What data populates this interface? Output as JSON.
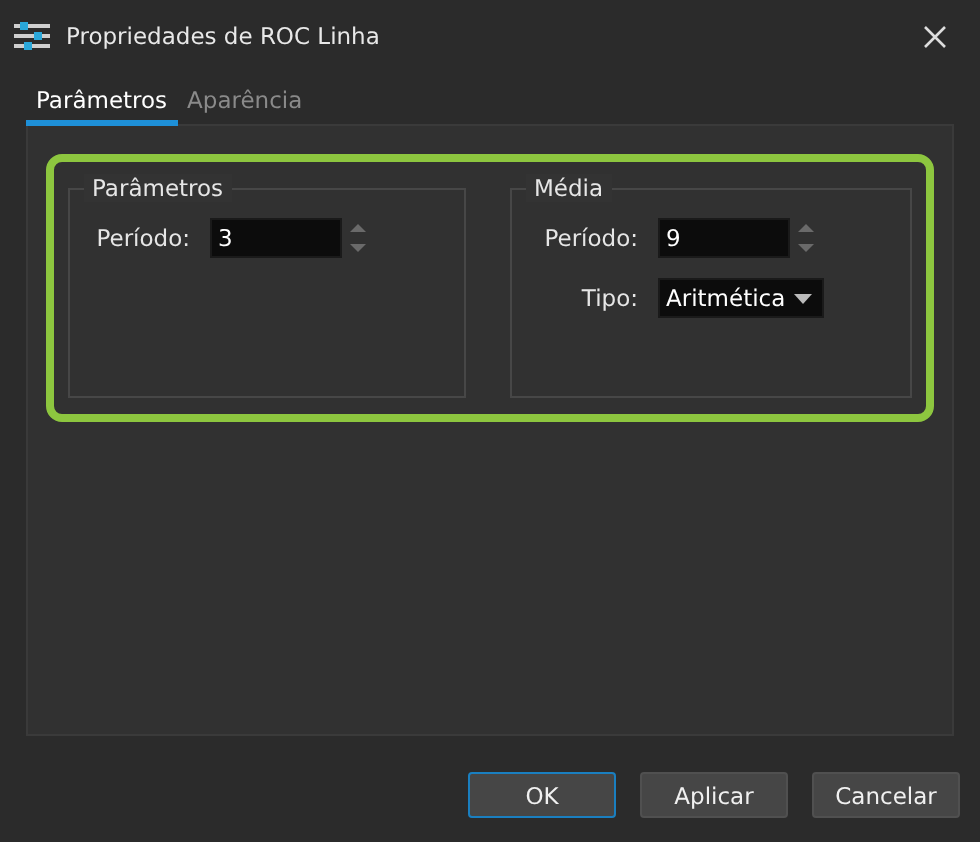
{
  "window": {
    "title": "Propriedades de ROC Linha"
  },
  "tabs": [
    {
      "label": "Parâmetros",
      "selected": true
    },
    {
      "label": "Aparência",
      "selected": false
    }
  ],
  "groups": [
    {
      "title": "Parâmetros",
      "fields": [
        {
          "kind": "spin",
          "label": "Período:",
          "value": "3"
        }
      ]
    },
    {
      "title": "Média",
      "fields": [
        {
          "kind": "spin",
          "label": "Período:",
          "value": "9"
        },
        {
          "kind": "dropdown",
          "label": "Tipo:",
          "value": "Aritmética"
        }
      ]
    }
  ],
  "buttons": [
    {
      "label": "OK",
      "default": true
    },
    {
      "label": "Aplicar",
      "default": false
    },
    {
      "label": "Cancelar",
      "default": false
    }
  ]
}
